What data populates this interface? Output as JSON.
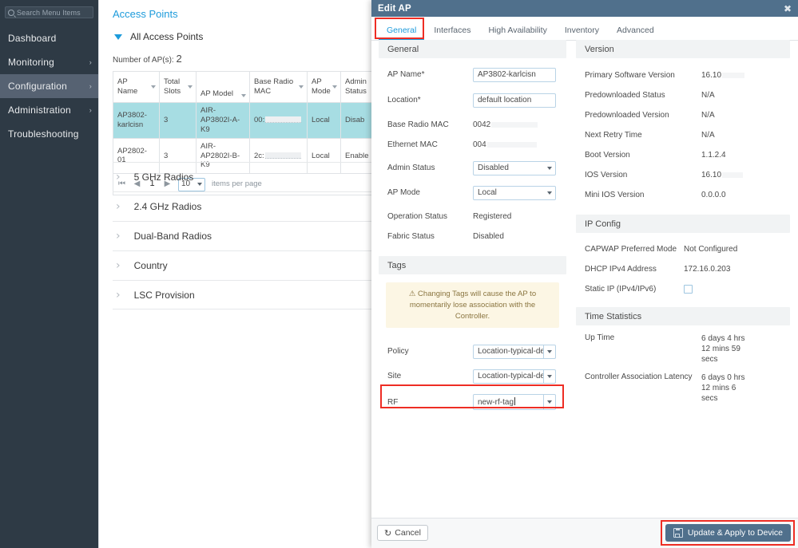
{
  "sidebar": {
    "search": {
      "placeholder": "Search Menu Items",
      "icon": "search-icon"
    },
    "items": [
      {
        "label": "Dashboard",
        "has_chevron": false,
        "active": false
      },
      {
        "label": "Monitoring",
        "has_chevron": true,
        "active": false
      },
      {
        "label": "Configuration",
        "has_chevron": true,
        "active": true
      },
      {
        "label": "Administration",
        "has_chevron": true,
        "active": false
      },
      {
        "label": "Troubleshooting",
        "has_chevron": false,
        "active": false
      }
    ],
    "chevron_glyph": "›"
  },
  "main": {
    "page_title": "Access Points",
    "section_title": "All Access Points",
    "ap_count_label": "Number of AP(s):",
    "ap_count_value": "2",
    "table": {
      "columns": [
        {
          "label": "AP Name",
          "sortable": true
        },
        {
          "label": "Total Slots",
          "sortable": true
        },
        {
          "label": "AP Model",
          "sortable": true
        },
        {
          "label": "Base Radio MAC",
          "sortable": true
        },
        {
          "label": "AP Mode",
          "sortable": true
        },
        {
          "label": "Admin Status",
          "sortable": false
        }
      ],
      "rows": [
        {
          "selected": true,
          "ap_name": "AP3802-karlcisn",
          "total_slots": "3",
          "ap_model": "AIR-AP3802I-A-K9",
          "base_radio_mac": "00:",
          "ap_mode": "Local",
          "admin_status": "Disab"
        },
        {
          "selected": false,
          "ap_name": "AP2802-01",
          "total_slots": "3",
          "ap_model": "AIR-AP2802I-B-K9",
          "base_radio_mac": "2c:",
          "ap_mode": "Local",
          "admin_status": "Enable"
        }
      ],
      "pager": {
        "first": "⏮",
        "prev": "◀",
        "current_page": "1",
        "next": "▶",
        "page_size": "10",
        "page_size_label": "items per page"
      }
    },
    "accordions": [
      {
        "label": "5 GHz Radios"
      },
      {
        "label": "2.4 GHz Radios"
      },
      {
        "label": "Dual-Band Radios"
      },
      {
        "label": "Country"
      },
      {
        "label": "LSC Provision"
      }
    ],
    "accordion_chevron": "›"
  },
  "modal": {
    "title": "Edit AP",
    "close_glyph": "✖",
    "tabs": [
      {
        "label": "General",
        "active": true,
        "highlighted": true
      },
      {
        "label": "Interfaces",
        "active": false,
        "highlighted": false
      },
      {
        "label": "High Availability",
        "active": false,
        "highlighted": false
      },
      {
        "label": "Inventory",
        "active": false,
        "highlighted": false
      },
      {
        "label": "Advanced",
        "active": false,
        "highlighted": false
      }
    ],
    "general": {
      "group_title": "General",
      "ap_name": {
        "label": "AP Name*",
        "value": "AP3802-karlcisn"
      },
      "location": {
        "label": "Location*",
        "value": "default location"
      },
      "base_radio_mac": {
        "label": "Base Radio MAC",
        "value": "0042"
      },
      "ethernet_mac": {
        "label": "Ethernet MAC",
        "value": "004"
      },
      "admin_status": {
        "label": "Admin Status",
        "value": "Disabled"
      },
      "ap_mode": {
        "label": "AP Mode",
        "value": "Local"
      },
      "operation_status": {
        "label": "Operation Status",
        "value": "Registered"
      },
      "fabric_status": {
        "label": "Fabric Status",
        "value": "Disabled"
      }
    },
    "tags": {
      "group_title": "Tags",
      "warning_icon": "warning-triangle-icon",
      "warning_text": "Changing Tags will cause the AP to momentarily lose association with the Controller.",
      "policy": {
        "label": "Policy",
        "value": "Location-typical-den"
      },
      "site": {
        "label": "Site",
        "value": "Location-typical-den"
      },
      "rf": {
        "label": "RF",
        "value": "new-rf-tag",
        "highlighted": true,
        "spellcheck_error": true
      }
    },
    "version": {
      "group_title": "Version",
      "primary_software_version": {
        "label": "Primary Software Version",
        "value": "16.10"
      },
      "predownloaded_status": {
        "label": "Predownloaded Status",
        "value": "N/A"
      },
      "predownloaded_version": {
        "label": "Predownloaded Version",
        "value": "N/A"
      },
      "next_retry_time": {
        "label": "Next Retry Time",
        "value": "N/A"
      },
      "boot_version": {
        "label": "Boot Version",
        "value": "1.1.2.4"
      },
      "ios_version": {
        "label": "IOS Version",
        "value": "16.10"
      },
      "mini_ios_version": {
        "label": "Mini IOS Version",
        "value": "0.0.0.0"
      }
    },
    "ip_config": {
      "group_title": "IP Config",
      "capwap_preferred_mode": {
        "label": "CAPWAP Preferred Mode",
        "value": "Not Configured"
      },
      "dhcp_ipv4_address": {
        "label": "DHCP IPv4 Address",
        "value": "172.16.0.203"
      },
      "static_ip": {
        "label": "Static IP (IPv4/IPv6)",
        "checked": false
      }
    },
    "time_statistics": {
      "group_title": "Time Statistics",
      "up_time": {
        "label": "Up Time",
        "value": "6 days 4 hrs 12 mins 59 secs"
      },
      "controller_association_latency": {
        "label": "Controller Association Latency",
        "value": "6 days 0 hrs 12 mins 6 secs"
      }
    },
    "footer": {
      "cancel_label": "Cancel",
      "cancel_icon": "undo-icon",
      "update_label": "Update & Apply to Device",
      "update_icon": "save-icon",
      "update_highlighted": true
    }
  },
  "colors": {
    "brand_blue": "#1d9bdb",
    "sidebar_bg": "#2e3a45",
    "sidebar_active": "#566272",
    "modal_header": "#50708c",
    "highlight_red": "#ee2d24",
    "row_selected": "#a7dde3",
    "warning_bg": "#fcf6e4"
  }
}
